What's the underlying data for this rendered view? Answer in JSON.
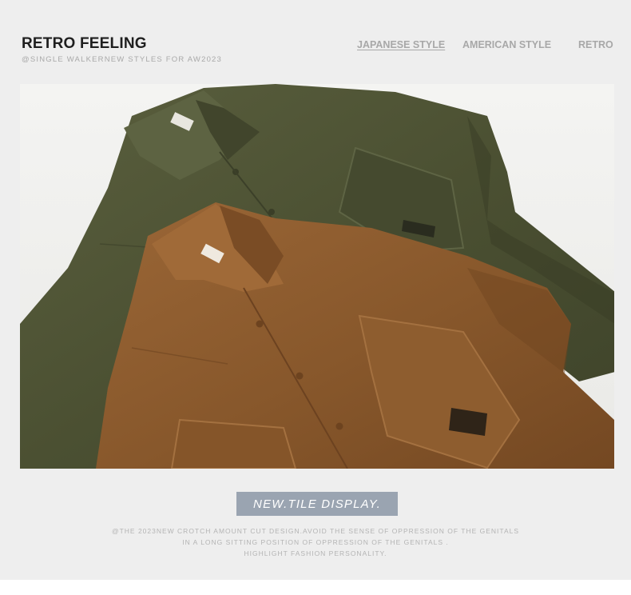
{
  "header": {
    "title": "RETRO FEELING",
    "subtitle": "@SINGLE WALKERNEW STYLES FOR AW2023"
  },
  "nav": {
    "items": [
      "JAPANESE STYLE",
      "AMERICAN STYLE",
      "RETRO"
    ],
    "active_index": 0
  },
  "photo": {
    "subject": "two folded short-sleeve work shirts, olive green and brown",
    "colors": {
      "olive": "#4d5233",
      "brown": "#8a5a2e",
      "background": "#f2f2f0"
    },
    "label_olive": "",
    "label_brown": ""
  },
  "badge": {
    "label": "NEW.TILE DISPLAY."
  },
  "description": {
    "lines": [
      "@THE 2023NEW CROTCH AMOUNT CUT DESIGN.AVOID THE SENSE OF OPPRESSION OF THE GENITALS",
      "IN A LONG SITTING POSITION OF OPPRESSION OF THE GENITALS .",
      "HIGHLIGHT FASHION PERSONALITY."
    ]
  }
}
